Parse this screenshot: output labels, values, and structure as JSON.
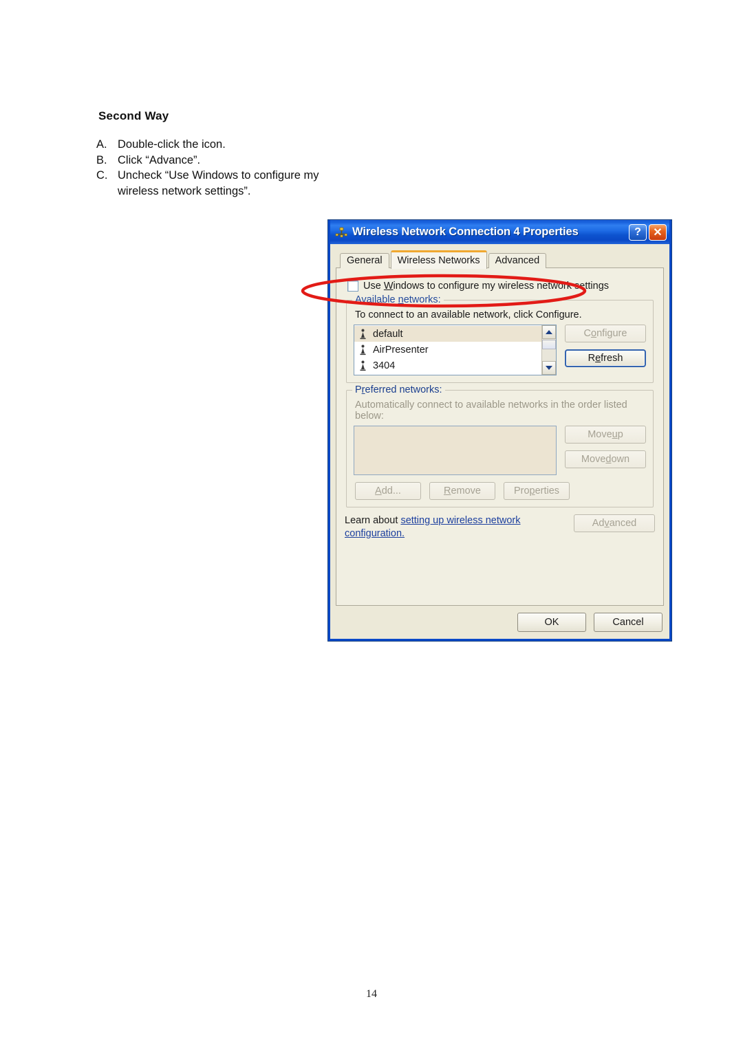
{
  "document": {
    "heading": "Second Way",
    "steps": [
      {
        "marker": "A.",
        "text": "Double-click the icon."
      },
      {
        "marker": "B.",
        "text": "Click “Advance”."
      },
      {
        "marker": "C.",
        "text": "Uncheck “Use Windows to configure my wireless network settings”."
      }
    ],
    "page_number": "14"
  },
  "dialog": {
    "title": "Wireless Network Connection 4 Properties",
    "titlebar": {
      "icon": "network-adapter-icon",
      "help_label": "?",
      "close_label": "✕"
    },
    "tabs": [
      {
        "label": "General",
        "active": false
      },
      {
        "label": "Wireless Networks",
        "active": true
      },
      {
        "label": "Advanced",
        "active": false
      }
    ],
    "use_windows_checkbox": {
      "label_pre": "Use ",
      "label_accel": "W",
      "label_post": "indows to configure my wireless network settings",
      "checked": false
    },
    "available_networks": {
      "legend_pre": "Available ",
      "legend_accel": "n",
      "legend_post": "etworks:",
      "hint": "To connect to an available network, click Configure.",
      "items": [
        {
          "name": "default",
          "selected": true
        },
        {
          "name": "AirPresenter",
          "selected": false
        },
        {
          "name": "3404",
          "selected": false
        }
      ],
      "configure_pre": "C",
      "configure_accel": "o",
      "configure_post": "nfigure",
      "configure_enabled": false,
      "refresh_pre": "R",
      "refresh_accel": "e",
      "refresh_post": "fresh",
      "refresh_enabled": true
    },
    "preferred_networks": {
      "legend_pre": "P",
      "legend_accel": "r",
      "legend_post": "eferred networks:",
      "hint": "Automatically connect to available networks in the order listed below:",
      "items": [],
      "move_up_pre": "Move ",
      "move_up_accel": "u",
      "move_up_post": "p",
      "move_down_pre": "Move ",
      "move_down_accel": "d",
      "move_down_post": "own",
      "add_pre": "",
      "add_accel": "A",
      "add_post": "dd...",
      "remove_pre": "",
      "remove_accel": "R",
      "remove_post": "emove",
      "properties_pre": "Pro",
      "properties_accel": "p",
      "properties_post": "erties"
    },
    "learn": {
      "prefix": "Learn about ",
      "link": "setting up wireless network configuration.",
      "advanced_pre": "Ad",
      "advanced_accel": "v",
      "advanced_post": "anced",
      "advanced_enabled": false
    },
    "footer": {
      "ok_label": "OK",
      "cancel_label": "Cancel"
    },
    "colors": {
      "titlebar_blue": "#0a49c8",
      "body_beige": "#ece9d8",
      "tab_active_accent": "#f0a830",
      "link_blue": "#1c3f9e",
      "selection_tan": "#ece4d2",
      "annotation_red": "#e21b16"
    }
  },
  "annotation": {
    "shape": "ellipse",
    "color": "#e21b16",
    "targets": "use-windows-checkbox-row"
  }
}
